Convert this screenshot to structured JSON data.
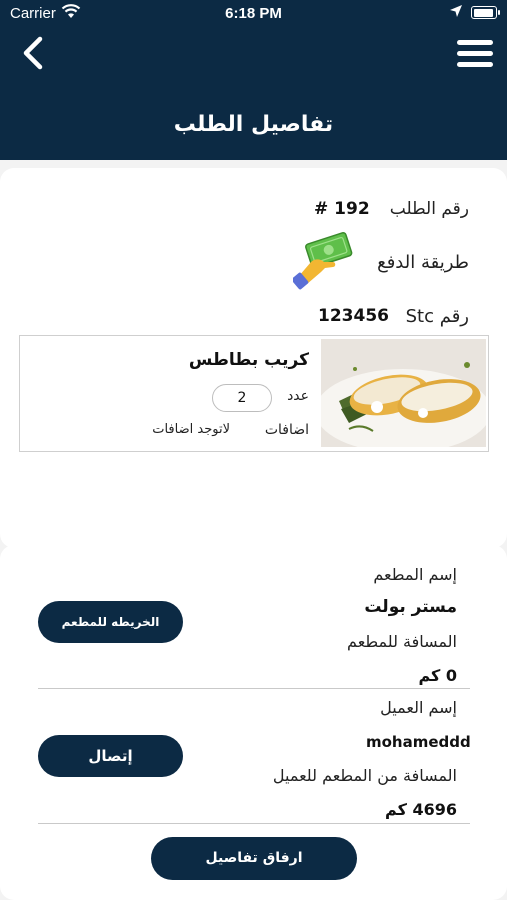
{
  "status_bar": {
    "carrier": "Carrier",
    "time": "6:18 PM"
  },
  "header": {
    "title": "تفاصيل الطلب"
  },
  "order": {
    "number_label": "رقم الطلب",
    "number_value": "# 192",
    "payment_label": "طريقة الدفع",
    "stc_label": "رقم Stc",
    "stc_value": "123456"
  },
  "item": {
    "name": "كريب بطاطس",
    "qty_label": "عدد",
    "qty_value": "2",
    "extras_label": "اضافات",
    "extras_value": "لاتوجد اضافات"
  },
  "restaurant": {
    "name_label": "إسم المطعم",
    "name_value": "مستر بولت",
    "distance_label": "المسافة للمطعم",
    "distance_value": "0 كم",
    "map_button": "الخريطه للمطعم"
  },
  "customer": {
    "name_label": "إسم العميل",
    "name_value": "mohameddd",
    "distance_label": "المسافة من المطعم للعميل",
    "distance_value": "4696 كم",
    "call_button": "إتصال"
  },
  "footer": {
    "attach_button": "ارفاق تفاصيل"
  },
  "colors": {
    "primary": "#0c2a44",
    "money_green": "#5fbf4a",
    "hand_yellow": "#f2b632"
  }
}
